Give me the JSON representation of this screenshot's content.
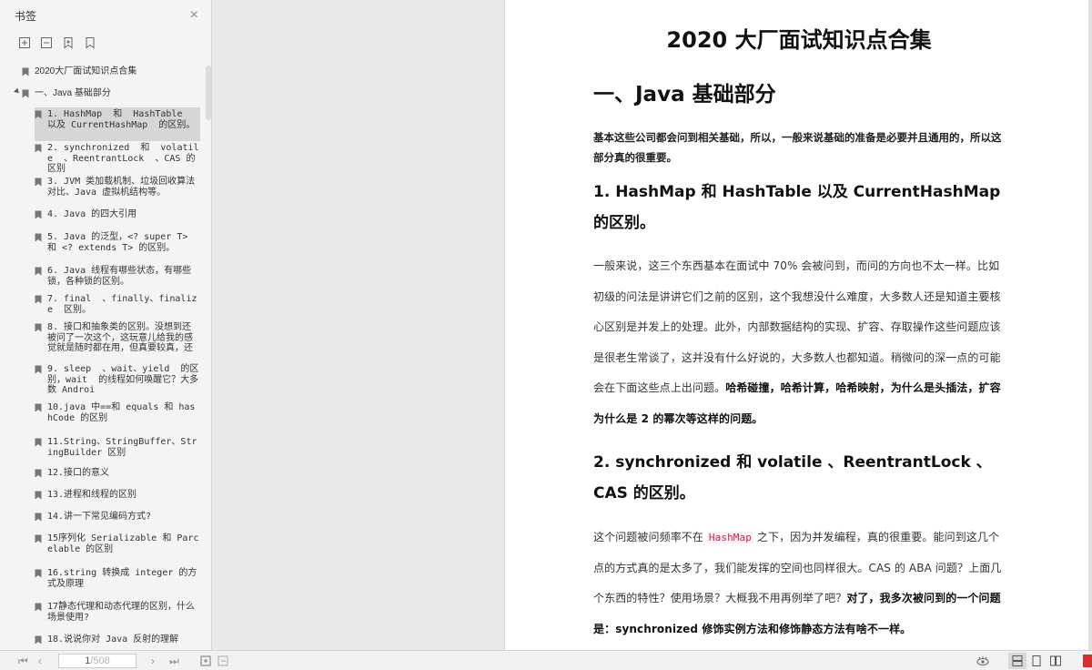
{
  "sidebar": {
    "title": "书签",
    "close": "×",
    "tools": [
      "expand-icon",
      "collapse-icon",
      "add-bookmark-icon",
      "bookmark-icon"
    ],
    "top_item": "2020大厂面试知识点合集",
    "section_item": "一、Java 基础部分",
    "children": [
      "1. HashMap  和  HashTable  以及 CurrentHashMap  的区别。",
      "2. synchronized  和  volatile  、ReentrantLock  、CAS 的区别",
      "3. JVM 类加载机制、垃圾回收算法对比、Java 虚拟机结构等。",
      "4. Java 的四大引用",
      "5. Java 的泛型，<? super T> 和 <? extends T> 的区别。",
      "6. Java 线程有哪些状态，有哪些锁，各种锁的区别。",
      "7. final  、finally、finalize  区别。",
      "8. 接口和抽象类的区别。没想到还被问了一次这个，这玩意儿给我的感觉就是随时都在用，但真要较真，还",
      "9. sleep  、wait、yield  的区别，wait  的线程如何唤醒它？大多数 Androi",
      "10.java 中==和 equals 和 hashCode 的区别",
      "11.String、StringBuffer、StringBuilder 区别",
      "12.接口的意义",
      "13.进程和线程的区别",
      "14.讲一下常见编码方式?",
      "15序列化 Serializable 和 Parcelable 的区别",
      "16.string 转换成 integer 的方式及原理",
      "17静态代理和动态代理的区别，什么场景使用?",
      "18.说说你对 Java 反射的理解"
    ]
  },
  "document": {
    "title": "2020 大厂面试知识点合集",
    "heading1": "一、Java  基础部分",
    "intro": "基本这些公司都会问到相关基础，所以，一般来说基础的准备是必要并且通用的，所以这部分真的很重要。",
    "q1_heading": "1. HashMap  和  HashTable  以及  CurrentHashMap  的区别。",
    "q1_text": "一般来说，这三个东西基本在面试中  70%  会被问到，而问的方向也不太一样。比如初级的问法是讲讲它们之前的区别，这个我想没什么难度，大多数人还是知道主要核心区别是并发上的处理。此外，内部数据结构的实现、扩容、存取操作这些问题应该是很老生常谈了，这并没有什么好说的，大多数人也都知道。稍微问的深一点的可能会在下面这些点上出问题。",
    "q1_bold": "哈希碰撞，哈希计算，哈希映射，为什么是头插法，扩容为什么是  2  的幂次等这样的问题。",
    "q2_heading": "2. synchronized  和  volatile  、ReentrantLock  、CAS  的区别。",
    "q2_text_a": "这个问题被问频率不在 ",
    "q2_code": "HashMap",
    "q2_text_b": " 之下，因为并发编程，真的很重要。能问到这几个点的方式真的是太多了，我们能发挥的空间也同样很大。CAS  的  ABA  问题？上面几个东西的特性？使用场景？大概我不用再例举了吧？",
    "q2_bold": "对了，我多次被问到的一个问题是：synchronized  修饰实例方法和修饰静态方法有啥不一样。"
  },
  "bottombar": {
    "first": "⏮",
    "prev": "‹",
    "current_page": "1",
    "total_pages": "/508",
    "next": "›",
    "last": "⏭"
  },
  "colors": {
    "sidebar_bg": "#f4f4f4",
    "selected_bg": "#d6d6d6",
    "page_bg": "#ffffff",
    "code_fg": "#c7254e",
    "brand": "#d32f2f"
  }
}
